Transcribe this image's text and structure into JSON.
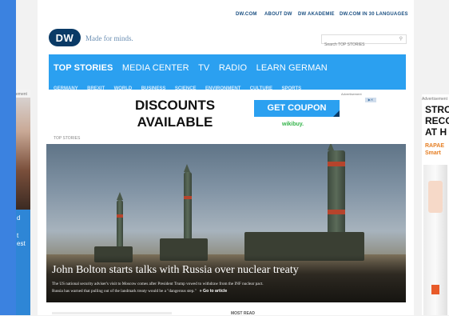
{
  "topbar": {
    "links": [
      "DW.COM",
      "ABOUT DW",
      "DW AKADEMIE",
      "DW.COM IN 30 LANGUAGES"
    ]
  },
  "brand": {
    "logo": "DW",
    "slogan": "Made for minds.",
    "color": "#0a3a66"
  },
  "search": {
    "placeholder": "Search TOP STORIES"
  },
  "nav": {
    "accent": "#2ba0f0",
    "main": [
      "TOP STORIES",
      "MEDIA CENTER",
      "TV",
      "RADIO",
      "LEARN GERMAN"
    ],
    "sub": [
      "GERMANY",
      "BREXIT",
      "WORLD",
      "BUSINESS",
      "SCIENCE",
      "ENVIRONMENT",
      "CULTURE",
      "SPORTS"
    ]
  },
  "ad": {
    "label": "Advertisement",
    "headline_line1": "DISCOUNTS",
    "headline_line2": "AVAILABLE",
    "button": "GET COUPON",
    "brand": "wikibuy."
  },
  "section": {
    "label": "TOP STORIES"
  },
  "story": {
    "headline": "John Bolton starts talks with Russia over nuclear treaty",
    "teaser_line1": "The US national security adviser's visit to Moscow comes after President Trump vowed to withdraw from the INF nuclear pact.",
    "teaser_line2": "Russia has warned that pulling out of the landmark treaty would be a \"dangerous step.\"",
    "goto": "» Go to article"
  },
  "most_read": {
    "label": "MOST READ"
  },
  "side_ads": {
    "left_label": "ement",
    "left_text": [
      "d",
      "t",
      "est"
    ],
    "right_label": "Advertisement",
    "right_big": [
      "STRO",
      "RECO",
      "AT H"
    ],
    "right_orange": [
      "RAPAE",
      "Smart"
    ]
  }
}
